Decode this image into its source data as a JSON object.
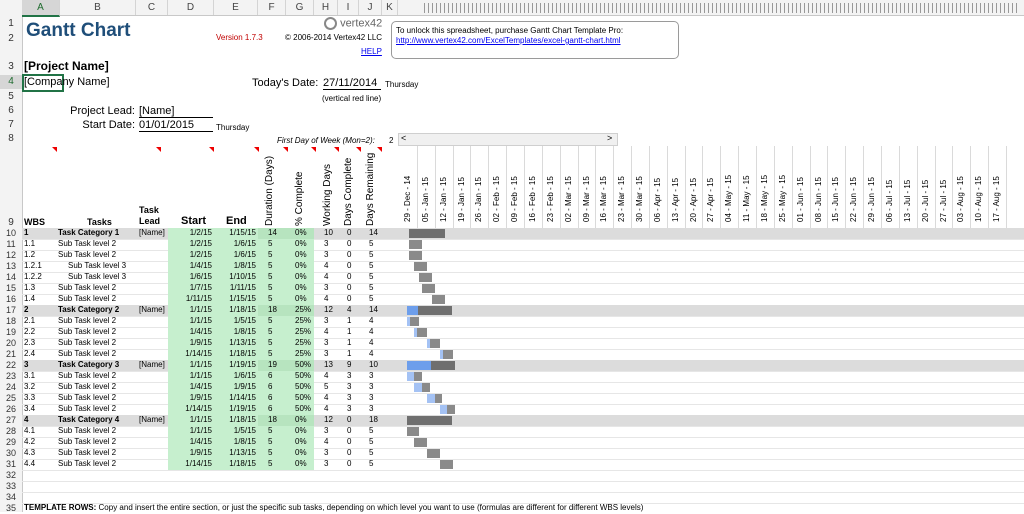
{
  "columns": [
    "A",
    "B",
    "C",
    "D",
    "E",
    "F",
    "G",
    "H",
    "I",
    "J",
    "K"
  ],
  "rows": [
    "1",
    "2",
    "3",
    "4",
    "5",
    "6",
    "7",
    "8",
    "9",
    "10",
    "11",
    "12",
    "13",
    "14",
    "15",
    "16",
    "17",
    "18",
    "19",
    "20",
    "21",
    "22",
    "23",
    "24",
    "25",
    "26",
    "27",
    "28",
    "29",
    "30",
    "31",
    "32",
    "33",
    "34",
    "35"
  ],
  "title": "Gantt Chart",
  "version": "Version 1.7.3",
  "copyright": "© 2006-2014 Vertex42 LLC",
  "logo_text": "vertex42",
  "help": "HELP",
  "unlock": {
    "text": "To unlock this spreadsheet, purchase Gantt Chart Template Pro:",
    "link": "http://www.vertex42.com/ExcelTemplates/excel-gantt-chart.html"
  },
  "project_name": "[Project Name]",
  "company_name": "[Company Name]",
  "todays_date": {
    "label": "Today's Date:",
    "value": "27/11/2014",
    "weekday": "Thursday",
    "note": "(vertical red line)"
  },
  "project_lead": {
    "label": "Project Lead:",
    "value": "[Name]"
  },
  "start_date": {
    "label": "Start Date:",
    "value": "01/01/2015",
    "weekday": "Thursday"
  },
  "first_day": {
    "label": "First Day of Week (Mon=2):",
    "value": "2"
  },
  "scroll": {
    "left": "<",
    "right": ">"
  },
  "headers": {
    "wbs": "WBS",
    "tasks": "Tasks",
    "task_lead_1": "Task",
    "task_lead_2": "Lead",
    "start": "Start",
    "end": "End",
    "duration": "Duration (Days)",
    "pct_complete": "% Complete",
    "working_days": "Working Days",
    "days_complete": "Days Complete",
    "days_remaining": "Days Remaining"
  },
  "timeline": [
    "29 - Dec - 14",
    "05 - Jan - 15",
    "12 - Jan - 15",
    "19 - Jan - 15",
    "26 - Jan - 15",
    "02 - Feb - 15",
    "09 - Feb - 15",
    "16 - Feb - 15",
    "23 - Feb - 15",
    "02 - Mar - 15",
    "09 - Mar - 15",
    "16 - Mar - 15",
    "23 - Mar - 15",
    "30 - Mar - 15",
    "06 - Apr - 15",
    "13 - Apr - 15",
    "20 - Apr - 15",
    "27 - Apr - 15",
    "04 - May - 15",
    "11 - May - 15",
    "18 - May - 15",
    "25 - May - 15",
    "01 - Jun - 15",
    "08 - Jun - 15",
    "15 - Jun - 15",
    "22 - Jun - 15",
    "29 - Jun - 15",
    "06 - Jul - 15",
    "13 - Jul - 15",
    "20 - Jul - 15",
    "27 - Jul - 15",
    "03 - Aug - 15",
    "10 - Aug - 15",
    "17 - Aug - 15"
  ],
  "tasks": [
    {
      "row": "10",
      "wbs": "1",
      "name": "Task Category 1",
      "lead": "[Name]",
      "start": "1/2/15",
      "end": "1/15/15",
      "duration": "14",
      "pct": "0%",
      "working": "10",
      "done": "0",
      "remaining": "14",
      "category": true,
      "bar_start": "2015-01-02",
      "bar_end": "2015-01-15",
      "progress": 0
    },
    {
      "row": "11",
      "wbs": "1.1",
      "name": "Sub Task level 2",
      "lead": "",
      "start": "1/2/15",
      "end": "1/6/15",
      "duration": "5",
      "pct": "0%",
      "working": "3",
      "done": "0",
      "remaining": "5",
      "level": 2,
      "bar_start": "2015-01-02",
      "bar_end": "2015-01-06",
      "progress": 0
    },
    {
      "row": "12",
      "wbs": "1.2",
      "name": "Sub Task level 2",
      "lead": "",
      "start": "1/2/15",
      "end": "1/6/15",
      "duration": "5",
      "pct": "0%",
      "working": "3",
      "done": "0",
      "remaining": "5",
      "level": 2,
      "bar_start": "2015-01-02",
      "bar_end": "2015-01-06",
      "progress": 0
    },
    {
      "row": "13",
      "wbs": "1.2.1",
      "name": "Sub Task level 3",
      "lead": "",
      "start": "1/4/15",
      "end": "1/8/15",
      "duration": "5",
      "pct": "0%",
      "working": "4",
      "done": "0",
      "remaining": "5",
      "level": 3,
      "bar_start": "2015-01-04",
      "bar_end": "2015-01-08",
      "progress": 0
    },
    {
      "row": "14",
      "wbs": "1.2.2",
      "name": "Sub Task level 3",
      "lead": "",
      "start": "1/6/15",
      "end": "1/10/15",
      "duration": "5",
      "pct": "0%",
      "working": "4",
      "done": "0",
      "remaining": "5",
      "level": 3,
      "bar_start": "2015-01-06",
      "bar_end": "2015-01-10",
      "progress": 0
    },
    {
      "row": "15",
      "wbs": "1.3",
      "name": "Sub Task level 2",
      "lead": "",
      "start": "1/7/15",
      "end": "1/11/15",
      "duration": "5",
      "pct": "0%",
      "working": "3",
      "done": "0",
      "remaining": "5",
      "level": 2,
      "bar_start": "2015-01-07",
      "bar_end": "2015-01-11",
      "progress": 0
    },
    {
      "row": "16",
      "wbs": "1.4",
      "name": "Sub Task level 2",
      "lead": "",
      "start": "1/11/15",
      "end": "1/15/15",
      "duration": "5",
      "pct": "0%",
      "working": "4",
      "done": "0",
      "remaining": "5",
      "level": 2,
      "bar_start": "2015-01-11",
      "bar_end": "2015-01-15",
      "progress": 0
    },
    {
      "row": "17",
      "wbs": "2",
      "name": "Task Category 2",
      "lead": "[Name]",
      "start": "1/1/15",
      "end": "1/18/15",
      "duration": "18",
      "pct": "25%",
      "working": "12",
      "done": "4",
      "remaining": "14",
      "category": true,
      "bar_start": "2015-01-01",
      "bar_end": "2015-01-18",
      "progress": 0.25
    },
    {
      "row": "18",
      "wbs": "2.1",
      "name": "Sub Task level 2",
      "lead": "",
      "start": "1/1/15",
      "end": "1/5/15",
      "duration": "5",
      "pct": "25%",
      "working": "3",
      "done": "1",
      "remaining": "4",
      "level": 2,
      "bar_start": "2015-01-01",
      "bar_end": "2015-01-05",
      "progress": 0.25
    },
    {
      "row": "19",
      "wbs": "2.2",
      "name": "Sub Task level 2",
      "lead": "",
      "start": "1/4/15",
      "end": "1/8/15",
      "duration": "5",
      "pct": "25%",
      "working": "4",
      "done": "1",
      "remaining": "4",
      "level": 2,
      "bar_start": "2015-01-04",
      "bar_end": "2015-01-08",
      "progress": 0.25
    },
    {
      "row": "20",
      "wbs": "2.3",
      "name": "Sub Task level 2",
      "lead": "",
      "start": "1/9/15",
      "end": "1/13/15",
      "duration": "5",
      "pct": "25%",
      "working": "3",
      "done": "1",
      "remaining": "4",
      "level": 2,
      "bar_start": "2015-01-09",
      "bar_end": "2015-01-13",
      "progress": 0.25
    },
    {
      "row": "21",
      "wbs": "2.4",
      "name": "Sub Task level 2",
      "lead": "",
      "start": "1/14/15",
      "end": "1/18/15",
      "duration": "5",
      "pct": "25%",
      "working": "3",
      "done": "1",
      "remaining": "4",
      "level": 2,
      "bar_start": "2015-01-14",
      "bar_end": "2015-01-18",
      "progress": 0.25
    },
    {
      "row": "22",
      "wbs": "3",
      "name": "Task Category 3",
      "lead": "[Name]",
      "start": "1/1/15",
      "end": "1/19/15",
      "duration": "19",
      "pct": "50%",
      "working": "13",
      "done": "9",
      "remaining": "10",
      "category": true,
      "bar_start": "2015-01-01",
      "bar_end": "2015-01-19",
      "progress": 0.5
    },
    {
      "row": "23",
      "wbs": "3.1",
      "name": "Sub Task level 2",
      "lead": "",
      "start": "1/1/15",
      "end": "1/6/15",
      "duration": "6",
      "pct": "50%",
      "working": "4",
      "done": "3",
      "remaining": "3",
      "level": 2,
      "bar_start": "2015-01-01",
      "bar_end": "2015-01-06",
      "progress": 0.5
    },
    {
      "row": "24",
      "wbs": "3.2",
      "name": "Sub Task level 2",
      "lead": "",
      "start": "1/4/15",
      "end": "1/9/15",
      "duration": "6",
      "pct": "50%",
      "working": "5",
      "done": "3",
      "remaining": "3",
      "level": 2,
      "bar_start": "2015-01-04",
      "bar_end": "2015-01-09",
      "progress": 0.5
    },
    {
      "row": "25",
      "wbs": "3.3",
      "name": "Sub Task level 2",
      "lead": "",
      "start": "1/9/15",
      "end": "1/14/15",
      "duration": "6",
      "pct": "50%",
      "working": "4",
      "done": "3",
      "remaining": "3",
      "level": 2,
      "bar_start": "2015-01-09",
      "bar_end": "2015-01-14",
      "progress": 0.5
    },
    {
      "row": "26",
      "wbs": "3.4",
      "name": "Sub Task level 2",
      "lead": "",
      "start": "1/14/15",
      "end": "1/19/15",
      "duration": "6",
      "pct": "50%",
      "working": "4",
      "done": "3",
      "remaining": "3",
      "level": 2,
      "bar_start": "2015-01-14",
      "bar_end": "2015-01-19",
      "progress": 0.5
    },
    {
      "row": "27",
      "wbs": "4",
      "name": "Task Category 4",
      "lead": "[Name]",
      "start": "1/1/15",
      "end": "1/18/15",
      "duration": "18",
      "pct": "0%",
      "working": "12",
      "done": "0",
      "remaining": "18",
      "category": true,
      "bar_start": "2015-01-01",
      "bar_end": "2015-01-18",
      "progress": 0
    },
    {
      "row": "28",
      "wbs": "4.1",
      "name": "Sub Task level 2",
      "lead": "",
      "start": "1/1/15",
      "end": "1/5/15",
      "duration": "5",
      "pct": "0%",
      "working": "3",
      "done": "0",
      "remaining": "5",
      "level": 2,
      "bar_start": "2015-01-01",
      "bar_end": "2015-01-05",
      "progress": 0
    },
    {
      "row": "29",
      "wbs": "4.2",
      "name": "Sub Task level 2",
      "lead": "",
      "start": "1/4/15",
      "end": "1/8/15",
      "duration": "5",
      "pct": "0%",
      "working": "4",
      "done": "0",
      "remaining": "5",
      "level": 2,
      "bar_start": "2015-01-04",
      "bar_end": "2015-01-08",
      "progress": 0
    },
    {
      "row": "30",
      "wbs": "4.3",
      "name": "Sub Task level 2",
      "lead": "",
      "start": "1/9/15",
      "end": "1/13/15",
      "duration": "5",
      "pct": "0%",
      "working": "3",
      "done": "0",
      "remaining": "5",
      "level": 2,
      "bar_start": "2015-01-09",
      "bar_end": "2015-01-13",
      "progress": 0
    },
    {
      "row": "31",
      "wbs": "4.4",
      "name": "Sub Task level 2",
      "lead": "",
      "start": "1/14/15",
      "end": "1/18/15",
      "duration": "5",
      "pct": "0%",
      "working": "3",
      "done": "0",
      "remaining": "5",
      "level": 2,
      "bar_start": "2015-01-14",
      "bar_end": "2015-01-18",
      "progress": 0
    }
  ],
  "template_note": {
    "bold": "TEMPLATE ROWS:",
    "text": " Copy and insert the entire section, or just the specific sub tasks, depending on which level you want to use (formulas are different for different WBS levels)"
  },
  "colors": {
    "title": "#1f4e79",
    "version": "#c00000",
    "link": "#0000ee",
    "category_band": "#dcdcdc",
    "date_fill": "#c6efce",
    "bar_dark": "#6f6f6f",
    "bar_blue": "#6d9eeb"
  }
}
